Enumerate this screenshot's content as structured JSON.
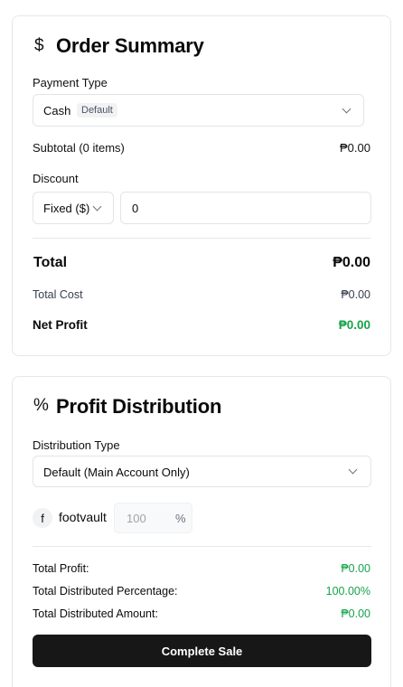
{
  "order_summary": {
    "icon": "dollar-icon",
    "icon_glyph": "$",
    "title": "Order Summary",
    "payment_type_label": "Payment Type",
    "payment_type_value": "Cash",
    "payment_type_badge": "Default",
    "subtotal_label": "Subtotal (0 items)",
    "subtotal_value": "₱0.00",
    "discount_label": "Discount",
    "discount_type_value": "Fixed ($)",
    "discount_amount_value": "0",
    "total_label": "Total",
    "total_value": "₱0.00",
    "total_cost_label": "Total Cost",
    "total_cost_value": "₱0.00",
    "net_profit_label": "Net Profit",
    "net_profit_value": "₱0.00"
  },
  "profit_distribution": {
    "icon": "percent-icon",
    "icon_glyph": "%",
    "title": "Profit Distribution",
    "distribution_type_label": "Distribution Type",
    "distribution_type_value": "Default (Main Account Only)",
    "accounts": [
      {
        "avatar_letter": "f",
        "name": "footvault",
        "percent_placeholder": "100",
        "percent_suffix": "%"
      }
    ],
    "total_profit_label": "Total Profit:",
    "total_profit_value": "₱0.00",
    "total_distributed_percentage_label": "Total Distributed Percentage:",
    "total_distributed_percentage_value": "100.00%",
    "total_distributed_amount_label": "Total Distributed Amount:",
    "total_distributed_amount_value": "₱0.00",
    "complete_sale_label": "Complete Sale"
  },
  "colors": {
    "accent_green": "#16a34a",
    "button_bg": "#171717"
  }
}
